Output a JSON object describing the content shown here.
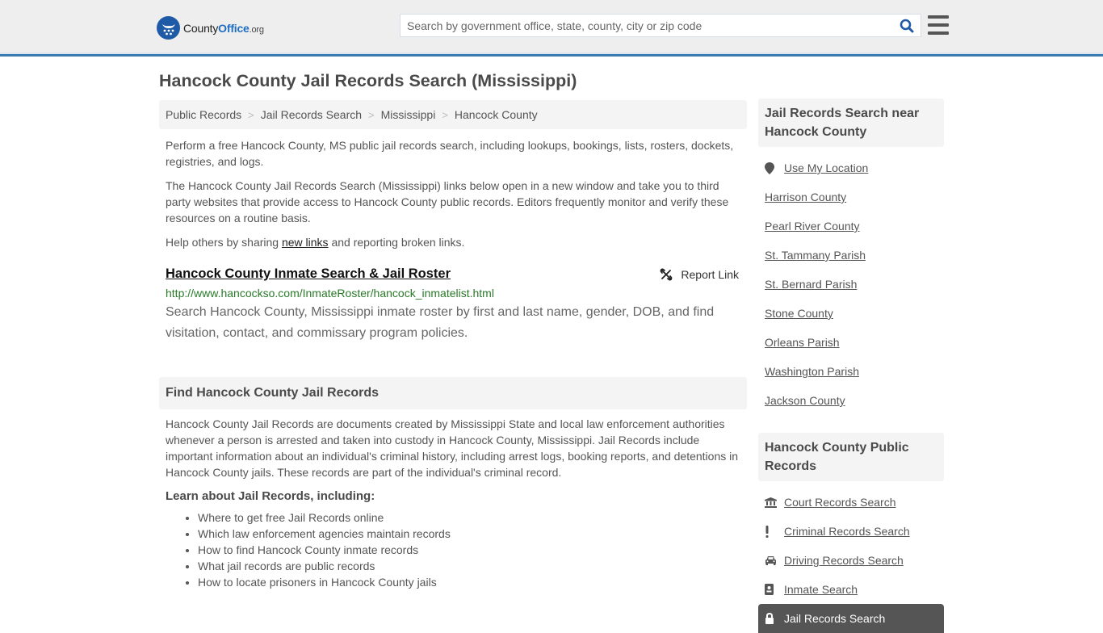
{
  "header": {
    "logo": {
      "county": "County",
      "office": "Office",
      "org": ".org"
    },
    "search": {
      "placeholder": "Search by government office, state, county, city or zip code",
      "value": ""
    },
    "icons": {
      "search": "search-icon",
      "menu": "hamburger-menu-icon"
    },
    "accent_color": "#3b7bb0",
    "brand_color": "#1f5aa6"
  },
  "page": {
    "title": "Hancock County Jail Records Search (Mississippi)",
    "breadcrumb": [
      {
        "label": "Public Records"
      },
      {
        "label": "Jail Records Search"
      },
      {
        "label": "Mississippi"
      },
      {
        "label": "Hancock County"
      }
    ],
    "breadcrumb_separator": ">"
  },
  "intro": {
    "p1": "Perform a free Hancock County, MS public jail records search, including lookups, bookings, lists, rosters, dockets, registries, and logs.",
    "p2": "The Hancock County Jail Records Search (Mississippi) links below open in a new window and take you to third party websites that provide access to Hancock County public records. Editors frequently monitor and verify these resources on a routine basis.",
    "p3_before": "Help others by sharing ",
    "p3_link": "new links",
    "p3_after": " and reporting broken links."
  },
  "result": {
    "title": "Hancock County Inmate Search & Jail Roster",
    "report_label": "Report Link",
    "url": "http://www.hancockso.com/InmateRoster/hancock_inmatelist.html",
    "description": "Search Hancock County, Mississippi inmate roster by first and last name, gender, DOB, and find visitation, contact, and commissary program policies."
  },
  "find_section": {
    "heading": "Find Hancock County Jail Records",
    "body": "Hancock County Jail Records are documents created by Mississippi State and local law enforcement authorities whenever a person is arrested and taken into custody in Hancock County, Mississippi. Jail Records include important information about an individual's criminal history, including arrest logs, booking reports, and detentions in Hancock County jails. These records are part of the individual's criminal record.",
    "learn_heading": "Learn about Jail Records, including:",
    "learn_items": [
      "Where to get free Jail Records online",
      "Which law enforcement agencies maintain records",
      "How to find Hancock County inmate records",
      "What jail records are public records",
      "How to locate prisoners in Hancock County jails"
    ]
  },
  "sidebar": {
    "nearby": {
      "heading": "Jail Records Search near Hancock County",
      "use_location": "Use My Location",
      "items": [
        "Harrison County",
        "Pearl River County",
        "St. Tammany Parish",
        "St. Bernard Parish",
        "Stone County",
        "Orleans Parish",
        "Washington Parish",
        "Jackson County"
      ]
    },
    "public_records": {
      "heading": "Hancock County Public Records",
      "items": [
        {
          "label": "Court Records Search",
          "icon": "courthouse-icon"
        },
        {
          "label": "Criminal Records Search",
          "icon": "exclamation-icon"
        },
        {
          "label": "Driving Records Search",
          "icon": "car-icon"
        },
        {
          "label": "Inmate Search",
          "icon": "id-badge-icon"
        },
        {
          "label": "Jail Records Search",
          "icon": "lock-icon",
          "active": true
        }
      ]
    }
  }
}
